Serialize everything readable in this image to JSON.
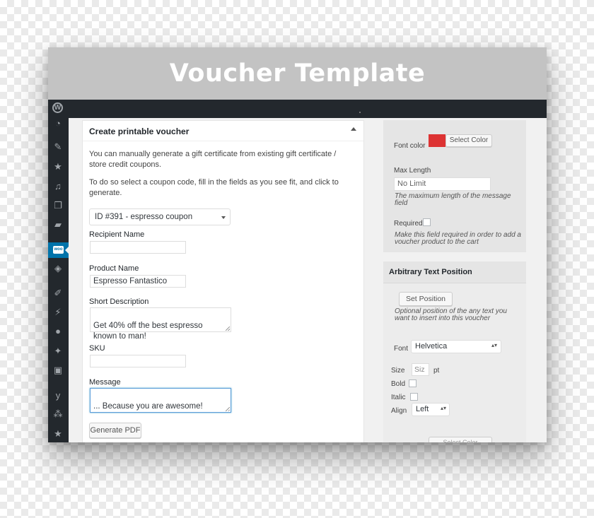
{
  "banner": {
    "title": "Voucher Template"
  },
  "sidebar": {
    "icons": [
      "gauge-icon",
      "pin-icon",
      "star-icon",
      "media-icon",
      "pages-icon",
      "comments-icon",
      "woocommerce-icon",
      "products-icon",
      "appearance-icon",
      "plugins-icon",
      "users-icon",
      "tools-icon",
      "settings-icon",
      "yoast-icon",
      "network-icon",
      "star-icon"
    ],
    "active_label": "woo"
  },
  "voucher_panel": {
    "title": "Create printable voucher",
    "intro": "You can manually generate a gift certificate from existing gift certificate / store credit coupons.",
    "instructions": "To do so select a coupon code, fill in the fields as you see fit, and click to generate.",
    "coupon_select": "ID #391 - espresso coupon",
    "recipient_label": "Recipient Name",
    "recipient_value": "",
    "product_label": "Product Name",
    "product_value": "Espresso Fantastico",
    "short_desc_label": "Short Description",
    "short_desc_value": "Get 40% off the best espresso\nknown to man!",
    "sku_label": "SKU",
    "sku_value": "",
    "message_label": "Message",
    "message_value": "... Because you are awesome!",
    "generate_button": "Generate PDF"
  },
  "field_settings": {
    "font_color_label": "Font color",
    "font_color_value": "#dd3333",
    "select_color_button": "Select Color",
    "max_length_label": "Max Length",
    "max_length_placeholder": "No Limit",
    "max_length_desc": "The maximum length of the message field",
    "required_label": "Required",
    "required_desc": "Make this field required in order to add a voucher product to the cart"
  },
  "text_position": {
    "title": "Arbitrary Text Position",
    "set_position_button": "Set Position",
    "set_position_desc": "Optional position of the any text you want to insert into this voucher",
    "font_label": "Font",
    "font_value": "Helvetica",
    "size_label": "Size",
    "size_placeholder": "Siz",
    "size_unit": "pt",
    "bold_label": "Bold",
    "italic_label": "Italic",
    "align_label": "Align",
    "align_value": "Left",
    "select_color_partial": "Select Color"
  }
}
